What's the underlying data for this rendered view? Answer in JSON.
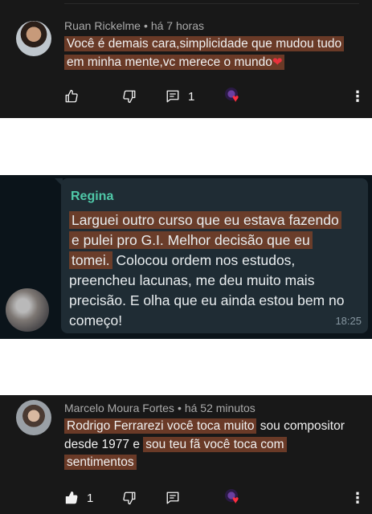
{
  "comment1": {
    "author": "Ruan Rickelme",
    "separator": "•",
    "time": "há 7 horas",
    "text_highlight": "Você é demais cara,simplicidade que mudou tudo em minha mente,vc merece o mundo",
    "emoji": "❤",
    "reply_count": "1"
  },
  "whatsapp": {
    "sender": "Regina",
    "highlighted": "Larguei outro curso que eu estava fazendo e pulei pro G.I. Melhor decisão que eu tomei.",
    "rest": " Colocou ordem nos estudos, preencheu lacunas, me deu muito mais precisão. E olha que eu ainda estou bem no começo!",
    "time": "18:25"
  },
  "comment2": {
    "author": "Marcelo Moura Fortes",
    "separator": "•",
    "time": "há 52 minutos",
    "hl1": "Rodrigo Ferrarezi você toca muito",
    "plain": " sou compositor desde 1977 e ",
    "hl2": "sou teu fã você toca com sentimentos",
    "like_count": "1"
  },
  "icons": {
    "like": "thumb-up-icon",
    "dislike": "thumb-down-icon",
    "reply": "comment-icon",
    "creator_heart": "creator-heart-icon",
    "more": "more-vertical-icon"
  },
  "colors": {
    "highlight": "#6a3a27",
    "yt_bg": "#181818",
    "wa_bg": "#0b141a",
    "wa_bubble": "#1f2c34",
    "wa_sender": "#4fc8a8"
  }
}
